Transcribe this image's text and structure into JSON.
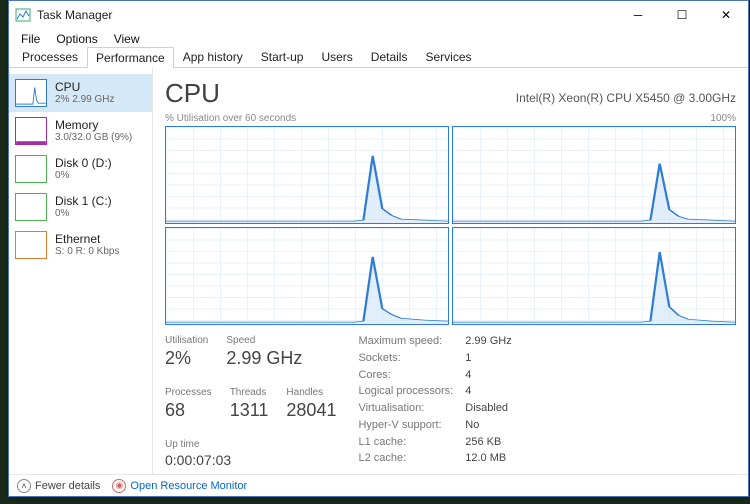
{
  "window": {
    "title": "Task Manager"
  },
  "menu": {
    "file": "File",
    "options": "Options",
    "view": "View"
  },
  "tabs": {
    "processes": "Processes",
    "performance": "Performance",
    "app_history": "App history",
    "startup": "Start-up",
    "users": "Users",
    "details": "Details",
    "services": "Services"
  },
  "sidebar": {
    "cpu": {
      "title": "CPU",
      "sub": "2%  2.99 GHz"
    },
    "memory": {
      "title": "Memory",
      "sub": "3.0/32.0 GB (9%)"
    },
    "disk0": {
      "title": "Disk 0 (D:)",
      "sub": "0%"
    },
    "disk1": {
      "title": "Disk 1 (C:)",
      "sub": "0%"
    },
    "ethernet": {
      "title": "Ethernet",
      "sub": "S: 0  R: 0 Kbps"
    }
  },
  "header": {
    "title": "CPU",
    "name": "Intel(R) Xeon(R) CPU X5450 @ 3.00GHz"
  },
  "chart_caption": {
    "left": "% Utilisation over 60 seconds",
    "right": "100%"
  },
  "stats": {
    "utilisation_label": "Utilisation",
    "utilisation": "2%",
    "speed_label": "Speed",
    "speed": "2.99 GHz",
    "processes_label": "Processes",
    "processes": "68",
    "threads_label": "Threads",
    "threads": "1311",
    "handles_label": "Handles",
    "handles": "28041",
    "uptime_label": "Up time",
    "uptime": "0:00:07:03"
  },
  "info": {
    "max_speed_k": "Maximum speed:",
    "max_speed_v": "2.99 GHz",
    "sockets_k": "Sockets:",
    "sockets_v": "1",
    "cores_k": "Cores:",
    "cores_v": "4",
    "lprocs_k": "Logical processors:",
    "lprocs_v": "4",
    "virt_k": "Virtualisation:",
    "virt_v": "Disabled",
    "hyperv_k": "Hyper-V support:",
    "hyperv_v": "No",
    "l1_k": "L1 cache:",
    "l1_v": "256 KB",
    "l2_k": "L2 cache:",
    "l2_v": "12.0 MB"
  },
  "status": {
    "fewer": "Fewer details",
    "orm": "Open Resource Monitor"
  },
  "chart_data": [
    {
      "type": "line",
      "title": "CPU Core 0",
      "xlabel": "seconds",
      "ylabel": "% utilisation",
      "ylim": [
        0,
        100
      ],
      "x": [
        0,
        5,
        10,
        15,
        20,
        25,
        30,
        35,
        40,
        42,
        44,
        46,
        48,
        50,
        55,
        60
      ],
      "y": [
        2,
        2,
        2,
        2,
        2,
        2,
        2,
        2,
        2,
        3,
        70,
        15,
        8,
        4,
        3,
        2
      ]
    },
    {
      "type": "line",
      "title": "CPU Core 1",
      "xlabel": "seconds",
      "ylabel": "% utilisation",
      "ylim": [
        0,
        100
      ],
      "x": [
        0,
        5,
        10,
        15,
        20,
        25,
        30,
        35,
        40,
        42,
        44,
        46,
        48,
        50,
        55,
        60
      ],
      "y": [
        2,
        2,
        2,
        2,
        2,
        2,
        2,
        2,
        2,
        3,
        62,
        14,
        7,
        4,
        3,
        2
      ]
    },
    {
      "type": "line",
      "title": "CPU Core 2",
      "xlabel": "seconds",
      "ylabel": "% utilisation",
      "ylim": [
        0,
        100
      ],
      "x": [
        0,
        5,
        10,
        15,
        20,
        25,
        30,
        35,
        40,
        42,
        44,
        46,
        48,
        50,
        55,
        60
      ],
      "y": [
        2,
        2,
        2,
        2,
        2,
        2,
        2,
        2,
        2,
        3,
        70,
        16,
        10,
        6,
        4,
        3
      ]
    },
    {
      "type": "line",
      "title": "CPU Core 3",
      "xlabel": "seconds",
      "ylabel": "% utilisation",
      "ylim": [
        0,
        100
      ],
      "x": [
        0,
        5,
        10,
        15,
        20,
        25,
        30,
        35,
        40,
        42,
        44,
        46,
        48,
        50,
        55,
        60
      ],
      "y": [
        2,
        2,
        2,
        2,
        2,
        2,
        2,
        2,
        2,
        3,
        75,
        18,
        9,
        5,
        3,
        2
      ]
    }
  ]
}
